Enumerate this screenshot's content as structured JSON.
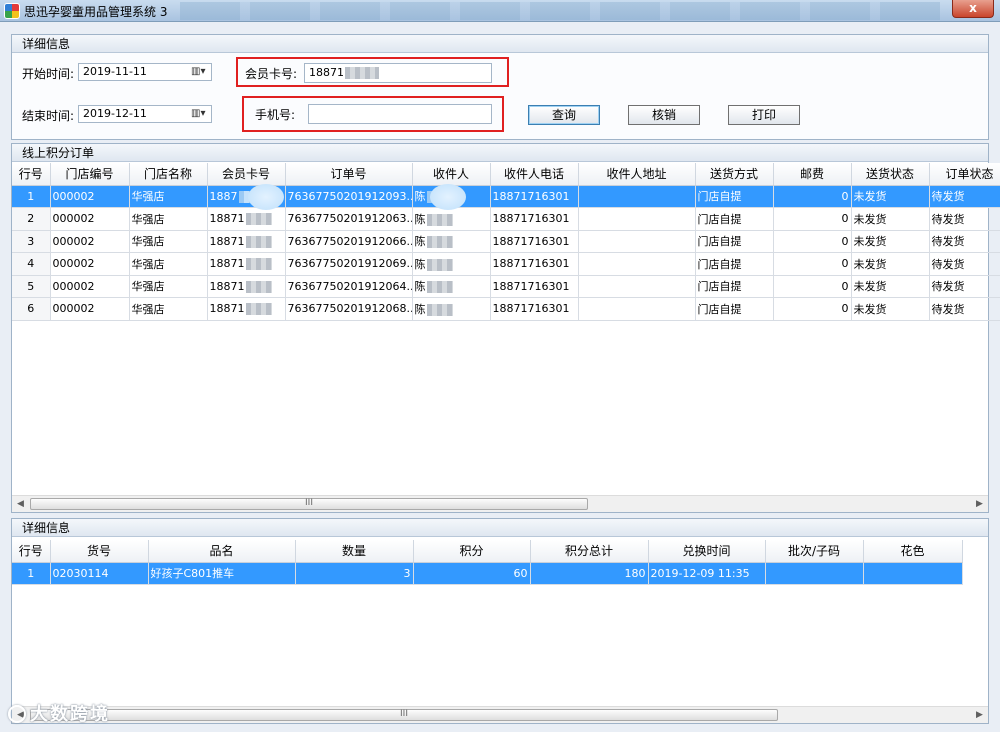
{
  "window": {
    "title": "思迅孕婴童用品管理系统 3",
    "close_label": "x"
  },
  "detail_panel": {
    "header": "详细信息",
    "start_label": "开始时间:",
    "start_value": "2019-11-11",
    "end_label": "结束时间:",
    "end_value": "2019-12-11",
    "member_card_label": "会员卡号:",
    "member_card_value": "18871",
    "phone_label": "手机号:",
    "phone_value": "",
    "query_label": "查询",
    "verify_label": "核销",
    "print_label": "打印",
    "date_picker_glyph": "▥▾"
  },
  "orders_panel": {
    "header": "线上积分订单",
    "columns": [
      "行号",
      "门店编号",
      "门店名称",
      "会员卡号",
      "订单号",
      "收件人",
      "收件人电话",
      "收件人地址",
      "送货方式",
      "邮费",
      "送货状态",
      "订单状态"
    ],
    "rows": [
      [
        "1",
        "000002",
        "华强店",
        "1887",
        "76367750201912093...",
        "陈",
        "18871716301",
        "",
        "门店自提",
        "0",
        "未发货",
        "待发货"
      ],
      [
        "2",
        "000002",
        "华强店",
        "18871",
        "76367750201912063...",
        "陈",
        "18871716301",
        "",
        "门店自提",
        "0",
        "未发货",
        "待发货"
      ],
      [
        "3",
        "000002",
        "华强店",
        "18871",
        "76367750201912066...",
        "陈",
        "18871716301",
        "",
        "门店自提",
        "0",
        "未发货",
        "待发货"
      ],
      [
        "4",
        "000002",
        "华强店",
        "18871",
        "76367750201912069...",
        "陈",
        "18871716301",
        "",
        "门店自提",
        "0",
        "未发货",
        "待发货"
      ],
      [
        "5",
        "000002",
        "华强店",
        "18871",
        "76367750201912064...",
        "陈",
        "18871716301",
        "",
        "门店自提",
        "0",
        "未发货",
        "待发货"
      ],
      [
        "6",
        "000002",
        "华强店",
        "18871",
        "76367750201912068...",
        "陈",
        "18871716301",
        "",
        "门店自提",
        "0",
        "未发货",
        "待发货"
      ]
    ],
    "selected_row": 0,
    "scroll_grip": "III"
  },
  "items_panel": {
    "header": "详细信息",
    "columns": [
      "行号",
      "货号",
      "品名",
      "数量",
      "积分",
      "积分总计",
      "兑换时间",
      "批次/子码",
      "花色"
    ],
    "rows": [
      [
        "1",
        "02030114",
        "好孩子C801推车",
        "3",
        "60",
        "180",
        "2019-12-09 11:35",
        "",
        ""
      ]
    ],
    "scroll_grip": "III"
  },
  "watermark": "大数跨境",
  "colors": {
    "selection": "#3399ff",
    "highlight_box": "#e02020",
    "panel_border": "#9fb3c8"
  }
}
